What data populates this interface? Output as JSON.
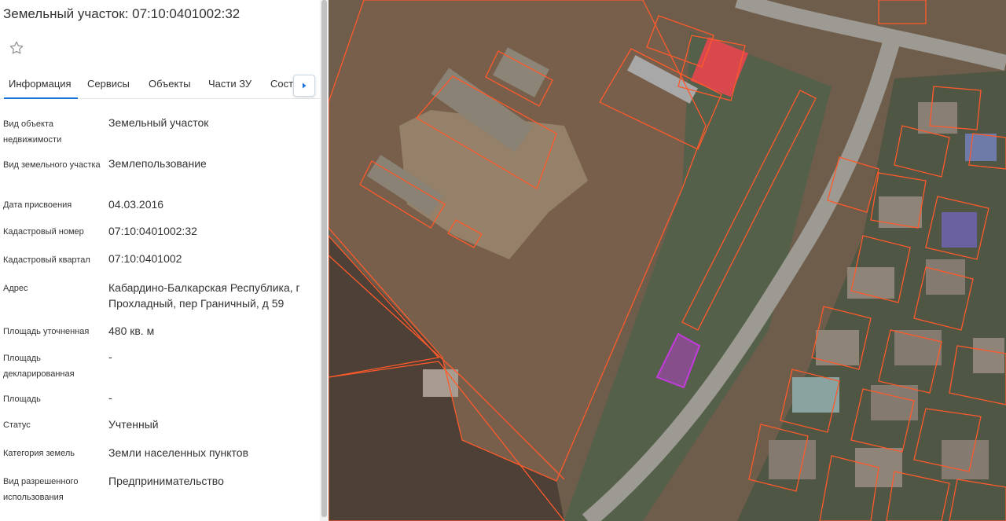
{
  "panel": {
    "title": "Земельный участок: 07:10:0401002:32",
    "tabs": [
      {
        "label": "Информация"
      },
      {
        "label": "Сервисы"
      },
      {
        "label": "Объекты"
      },
      {
        "label": "Части ЗУ"
      },
      {
        "label": "Соста"
      }
    ],
    "rows": [
      {
        "label": "Вид объекта недвижимости",
        "value": "Земельный участок"
      },
      {
        "label": "Вид земельного участка",
        "value": "Землепользование"
      },
      {
        "label": "Дата присвоения",
        "value": "04.03.2016"
      },
      {
        "label": "Кадастровый номер",
        "value": "07:10:0401002:32"
      },
      {
        "label": "Кадастровый квартал",
        "value": "07:10:0401002"
      },
      {
        "label": "Адрес",
        "value": "Кабардино-Балкарская Республика, г Прохладный, пер Граничный, д 59"
      },
      {
        "label": "Площадь уточненная",
        "value": "480 кв. м"
      },
      {
        "label": "Площадь декларированная",
        "value": "-"
      },
      {
        "label": "Площадь",
        "value": "-"
      },
      {
        "label": "Статус",
        "value": "Учтенный"
      },
      {
        "label": "Категория земель",
        "value": "Земли населенных пунктов"
      },
      {
        "label": "Вид разрешенного использования",
        "value": "Предпринимательство"
      }
    ]
  },
  "colors": {
    "parcel_border": "#ff5a2b",
    "selected_parcel": "#c33bdc",
    "tab_underline": "#1a73d9"
  },
  "icons": {
    "favorite": "star-outline-icon",
    "tabs_next": "chevron-right-icon"
  }
}
